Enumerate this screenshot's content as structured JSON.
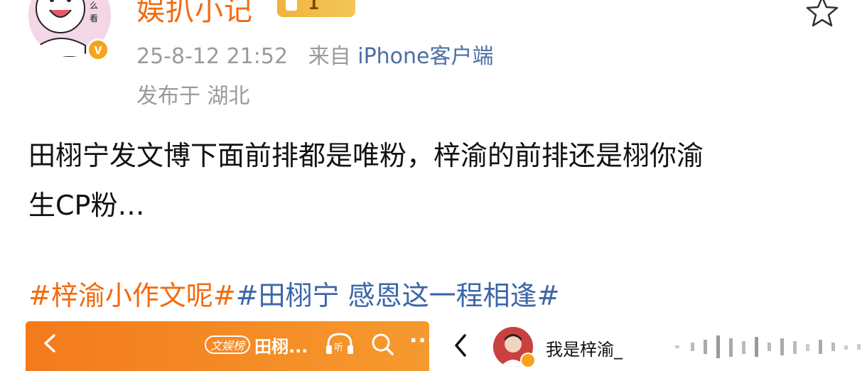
{
  "header": {
    "username": "娱扒小记",
    "level_badge": "1",
    "timestamp": "25-8-12 21:52",
    "source_prefix": "来自",
    "source": "iPhone客户端",
    "location": "发布于 湖北"
  },
  "post": {
    "line1": "田栩宁发文博下面前排都是唯粉，梓渝的前排还是栩你渝",
    "line2": "生CP粉…",
    "hashtags": [
      {
        "text": "#梓渝小作文呢#",
        "color": "#f36b0f"
      },
      {
        "text": "#田栩宁 感恩这一程相逢#",
        "color": "#3d66a8"
      }
    ]
  },
  "screenshot_left": {
    "pill": "文娱榜",
    "title": "田栩...",
    "listen_label": "听",
    "more": "···"
  },
  "screenshot_right": {
    "name": "我是梓渝_"
  },
  "colors": {
    "orange": "#f36b0f",
    "link_blue": "#3d66a8",
    "meta_gray": "#9a9a9a"
  },
  "icons": [
    "avatar-illustration",
    "verified-icon",
    "level-badge-icon",
    "favorite-star-icon",
    "back-arrow-icon",
    "listen-icon",
    "search-icon",
    "more-icon",
    "audio-bars-icon"
  ]
}
